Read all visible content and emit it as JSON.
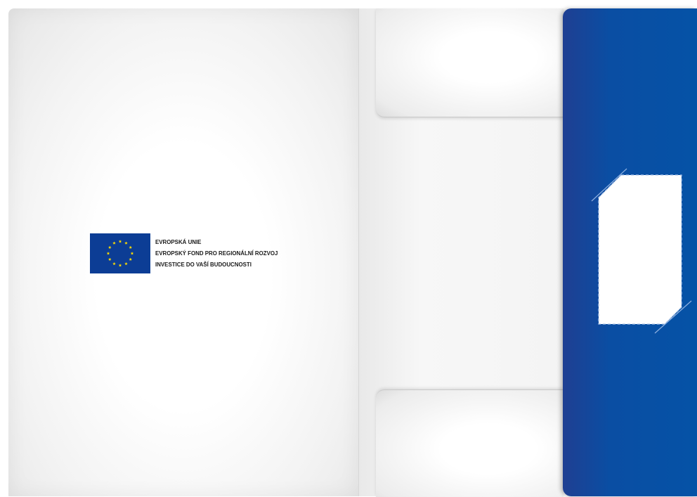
{
  "folder": {
    "colors": {
      "flap_blue": "#0552a6",
      "flag_blue": "#0c3d95",
      "flag_star": "#ffdd00",
      "paper": "#f4f4f4"
    },
    "eu_logo": {
      "lines": [
        "EVROPSKÁ UNIE",
        "EVROPSKÝ FOND PRO REGIONÁLNÍ ROZVOJ",
        "INVESTICE DO VAŠÍ BUDOUCNOSTI"
      ],
      "flag_icon": "eu-flag-icon",
      "star_count": 12
    },
    "card_slot_icon": "card-slot-icon"
  }
}
